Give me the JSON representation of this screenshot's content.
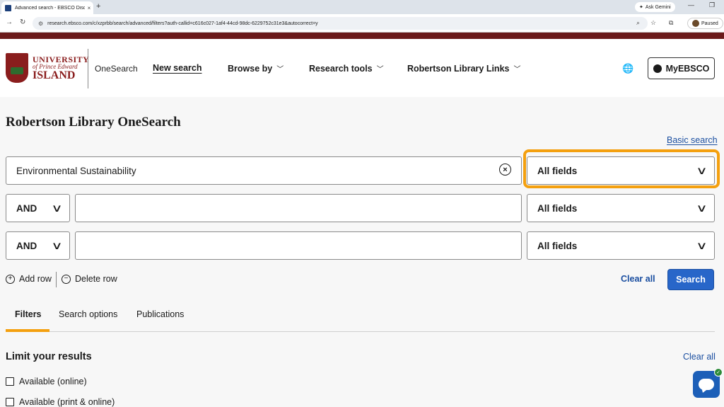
{
  "browser": {
    "tab_title": "Advanced search - EBSCO Disc",
    "tab_close": "×",
    "new_tab": "+",
    "gemini_label": "Ask Gemini",
    "url": "research.ebsco.com/c/xzprbb/search/advanced/filters?auth-callid=c616c027-1af4-44cd-98dc-6229752c31e3&autocorrect=y",
    "profile_status": "Paused"
  },
  "header": {
    "logo": {
      "line1": "UNIVERSITY",
      "line2": "of Prince Edward",
      "line3": "ISLAND"
    },
    "onesearch": "OneSearch",
    "nav": {
      "new_search": "New search",
      "browse_by": "Browse by",
      "research_tools": "Research tools",
      "library_links": "Robertson Library Links"
    },
    "myebsco": "MyEBSCO"
  },
  "main": {
    "title": "Robertson Library OneSearch",
    "basic_search": "Basic search",
    "rows": [
      {
        "operator": "",
        "query": "Environmental Sustainability",
        "field": "All fields"
      },
      {
        "operator": "AND",
        "query": "",
        "field": "All fields"
      },
      {
        "operator": "AND",
        "query": "",
        "field": "All fields"
      }
    ],
    "add_row": "Add row",
    "delete_row": "Delete row",
    "clear_all": "Clear all",
    "search": "Search",
    "tabs": [
      "Filters",
      "Search options",
      "Publications"
    ],
    "limit_title": "Limit your results",
    "limit_clear_all": "Clear all",
    "limits": [
      "Available (online)",
      "Available (print & online)"
    ]
  },
  "colors": {
    "accent_highlight": "#f4a00f",
    "link_blue": "#1a4ea0",
    "search_button": "#2866c9",
    "brand_strip": "#6b1a1a"
  }
}
